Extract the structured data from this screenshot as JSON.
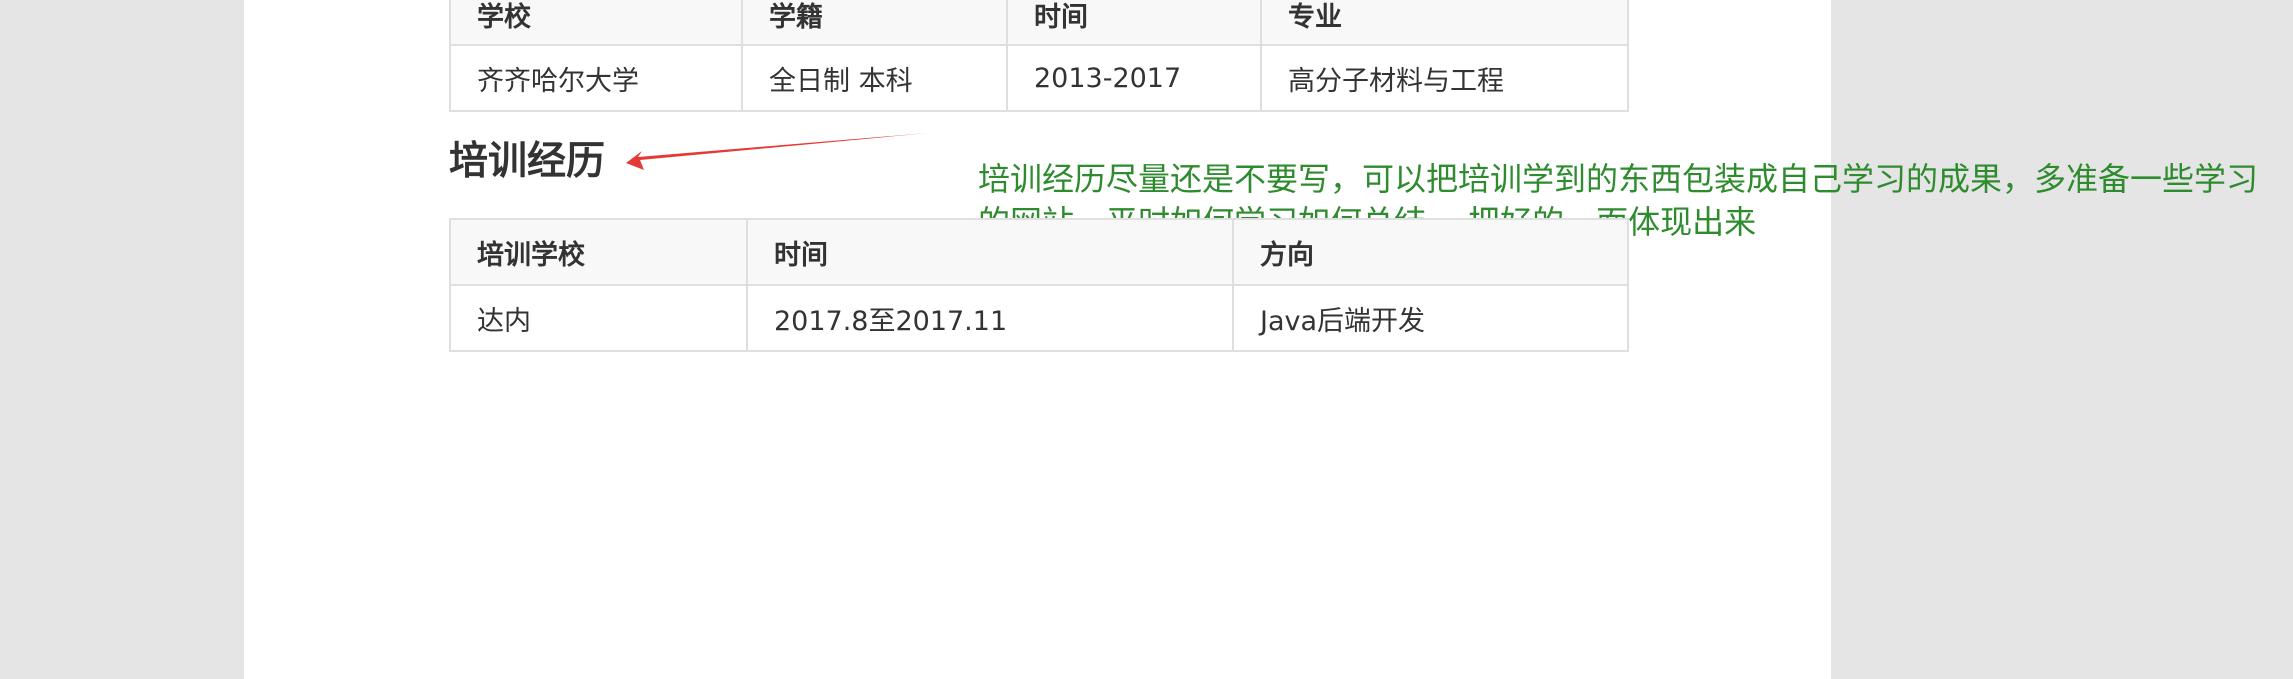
{
  "education": {
    "headers": [
      "学校",
      "学籍",
      "时间",
      "专业"
    ],
    "row": [
      "齐齐哈尔大学",
      "全日制 本科",
      "2013-2017",
      "高分子材料与工程"
    ]
  },
  "training_section": {
    "title": "培训经历",
    "headers": [
      "培训学校",
      "时间",
      "方向"
    ],
    "row": [
      "达内",
      "2017.8至2017.11",
      "Java后端开发"
    ]
  },
  "annotation": {
    "text": "培训经历尽量还是不要写，可以把培训学到的东西包装成自己学习的成果，多准备一些学习的网站，平时如何学习如何总结， 把好的一面体现出来",
    "color": "#2e8b2e"
  },
  "arrow_color": "#e53935"
}
